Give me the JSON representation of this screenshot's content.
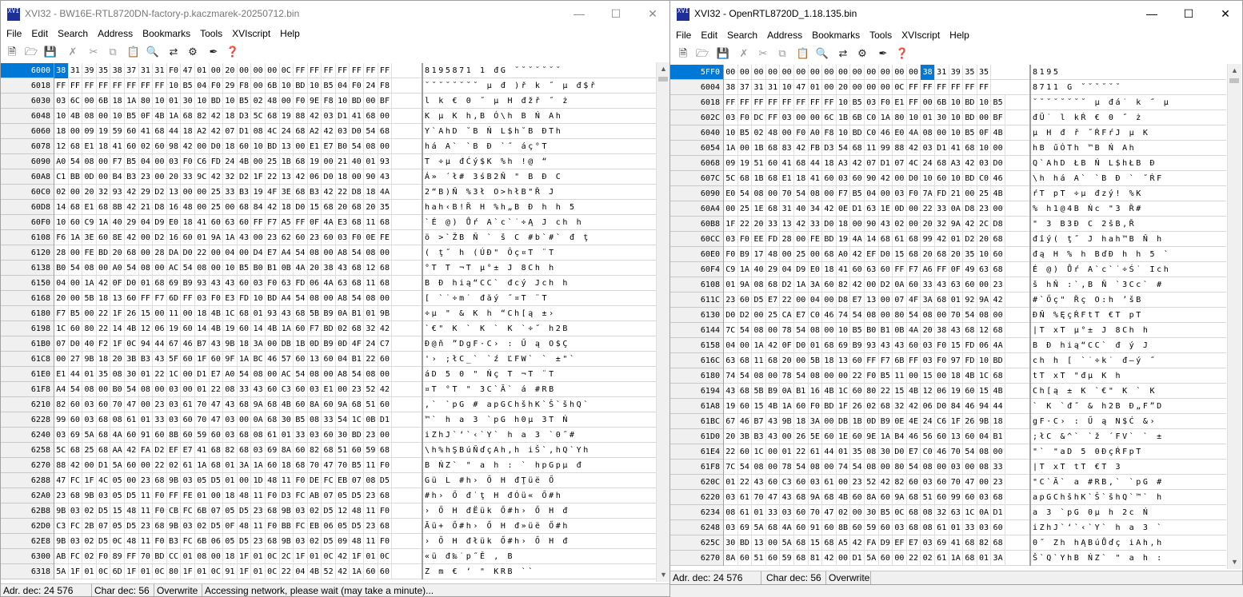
{
  "windows": [
    {
      "title": "XVI32 - BW16E-RTL8720DN-factory-p.kaczmarek-20250712.bin",
      "app_icon_label": "XVI",
      "menus": [
        "File",
        "Edit",
        "Search",
        "Address",
        "Bookmarks",
        "Tools",
        "XVIscript",
        "Help"
      ],
      "rows": [
        {
          "addr": "6000",
          "hex": "38 31 39 35 38 37 31 31 F0 47 01 00 20 00 00 00 0C FF FF FF FF FF FF FF",
          "text": "8195871 1 đG       ˘˘˘˘˘˘˘"
        },
        {
          "addr": "6018",
          "hex": "FF FF FF FF FF FF FF FF 10 B5 04 F0 29 F8 00 6B 10 BD 10 B5 04 F0 24 F8",
          "text": "˘˘˘˘˘˘˘˘ µ đ )ř k ˝ µ đ$ř"
        },
        {
          "addr": "6030",
          "hex": "03 6C 00 6B 18 1A 80 10 01 30 10 BD 10 B5 02 48 00 F0 9E F8 10 BD 00 BF",
          "text": " l  k   € 0 ˝ µ H  đžř ˝ ż"
        },
        {
          "addr": "6048",
          "hex": "10 4B 08 00 10 B5 0F 4B 1A 68 82 42 18 D3 5C 68 19 88 42 03 D1 41 68 00",
          "text": " K  µ K h‚B Ó\\h  B Ń Ah"
        },
        {
          "addr": "6060",
          "hex": "18 00 09 19 59 60 41 68 44 18 A2 42 07 D1 08 4C 24 68 A2 42 03 D0 54 68",
          "text": "   Y`AhD ˘B Ń L$h˘B ĐTh"
        },
        {
          "addr": "6078",
          "hex": "12 68 E1 18 41 60 02 60 98 42 00 D0 18 60 10 BD 13 00 E1 E7 B0 54 08 00",
          "text": " há A` `B Đ `˝  áç°T"
        },
        {
          "addr": "6090",
          "hex": "A0 54 08 00 F7 B5 04 00 03 F0 C6 FD 24 4B 00 25 1B 68 19 00 21 40 01 93",
          "text": " T  ÷µ  đĆý$K %h  !@ “"
        },
        {
          "addr": "60A8",
          "hex": "C1 BB 0D 00 B4 B3 23 00 20 33 9C 42 32 D2 1F 22 13 42 06 D0 18 00 90 43",
          "text": "Á»  ´ł# 3śB2Ň \" B Đ  C"
        },
        {
          "addr": "60C0",
          "hex": "02 00 20 32 93 42 29 D2 13 00 00 25 33 B3 19 4F 3E 68 B3 42 22 D8 18 4A",
          "text": "  2“B)Ň  %3ł O>hłB\"Ř J"
        },
        {
          "addr": "60D8",
          "hex": "14 68 E1 68 8B 42 21 D8 16 48 00 25 00 68 84 42 18 D0 15 68 20 68 20 35",
          "text": " hah‹B!Ř H %h„B Đ h h 5"
        },
        {
          "addr": "60F0",
          "hex": "10 60 C9 1A 40 29 04 D9 E0 18 41 60 63 60 FF F7 A5 FF 0F 4A E3 68 11 68",
          "text": " `É @) Ůŕ A`c`˙÷Ą J ch h"
        },
        {
          "addr": "6108",
          "hex": "F6 1A 3E 60 8E 42 00 D2 16 60 01 9A 1A 43 00 23 62 60 23 60 03 F0 0E FE",
          "text": "ö >`ŽB Ň ` š C #b`#` đ ţ"
        },
        {
          "addr": "6120",
          "hex": "28 00 FE BD 20 68 00 28 DA D0 22 00 04 00 D4 E7 A4 54 08 00 A8 54 08 00",
          "text": "( ţ˝ h (ÚĐ\"   Ôç¤T ¨T"
        },
        {
          "addr": "6138",
          "hex": "B0 54 08 00 A0 54 08 00 AC 54 08 00 10 B5 B0 B1 0B 4A 20 38 43 68 12 68",
          "text": "°T   T  ¬T µ°± J 8Ch h"
        },
        {
          "addr": "6150",
          "hex": "04 00 1A 42 0F D0 01 68 69 B9 93 43 43 60 03 F0 63 FD 06 4A 63 68 11 68",
          "text": "  B Đ hią“CC` đcý Jch h"
        },
        {
          "addr": "6168",
          "hex": "20 00 5B 18 13 60 FF F7 6D FF 03 F0 E3 FD 10 BD A4 54 08 00 A8 54 08 00",
          "text": " [ `˙÷m˙ đăý ˝¤T ¨T"
        },
        {
          "addr": "6180",
          "hex": "F7 B5 00 22 1F 26 15 00 11 00 18 4B 1C 68 01 93 43 68 5B B9 0A B1 01 9B",
          "text": "÷µ \" &   K h “Ch[ą ±› "
        },
        {
          "addr": "6198",
          "hex": "1C 60 80 22 14 4B 12 06 19 60 14 4B 19 60 14 4B 1A 60 F7 BD 02 68 32 42",
          "text": " `€\" K  ` K ` K `÷˝ h2B"
        },
        {
          "addr": "61B0",
          "hex": "07 D0 40 F2 1F 0C 94 44 67 46 B7 43 9B 18 3A 00 DB 1B 0D B9 0D 4F 24 C7",
          "text": " Đ@ň  ”DgF·C› : Ű  ą O$Ç"
        },
        {
          "addr": "61C8",
          "hex": "00 27 9B 18 20 3B B3 43 5F 60 1F 60 9F 1A BC 46 57 60 13 60 04 B1 22 60",
          "text": " '› ;łC_` `ź ĽFW` ` ±\"`"
        },
        {
          "addr": "61E0",
          "hex": "E1 44 01 35 08 30 01 22 1C 00 D1 E7 A0 54 08 00 AC 54 08 00 A8 54 08 00",
          "text": "áD 5 0 \" Ńç T ¬T ¨T"
        },
        {
          "addr": "61F8",
          "hex": "A4 54 08 00 B0 54 08 00 03 00 01 22 08 33 43 60 C3 60 03 E1 00 23 52 42",
          "text": "¤T °T  \" 3C`Ă` á #RB"
        },
        {
          "addr": "6210",
          "hex": "82 60 03 60 70 47 00 23 03 61 70 47 43 68 9A 68 4B 60 8A 60 9A 68 51 60",
          "text": "‚` `pG # apGChšhK`Š`šhQ`"
        },
        {
          "addr": "6228",
          "hex": "99 60 03 68 08 61 01 33 03 60 70 47 03 00 0A 68 30 B5 08 33 54 1C 0B D1",
          "text": "™` h a 3 `pG  h0µ 3T Ń"
        },
        {
          "addr": "6240",
          "hex": "03 69 5A 68 4A 60 91 60 8B 60 59 60 03 68 08 61 01 33 03 60 30 BD 23 00",
          "text": " iZhJ`‘`‹`Y` h a 3 `0˝#"
        },
        {
          "addr": "6258",
          "hex": "5C 68 25 68 AA 42 FA D2 EF E7 41 68 82 68 03 69 8A 60 82 68 51 60 59 68",
          "text": "\\h%hŞBúŇďçAh‚h iŠ`‚hQ`Yh"
        },
        {
          "addr": "6270",
          "hex": "88 42 00 D1 5A 60 00 22 02 61 1A 68 01 3A 1A 60 18 68 70 47 70 B5 11 F0",
          "text": "B ŃZ` \" a h : ` hpGpµ đ"
        },
        {
          "addr": "6288",
          "hex": "47 FC 1F 4C 05 00 23 68 9B 03 05 D5 01 00 1D 48 11 F0 DE FC EB 07 08 D5",
          "text": "Gü L  #h›  Ő  H đŢüë  Ő"
        },
        {
          "addr": "62A0",
          "hex": "23 68 9B 03 05 D5 11 F0 FF FE 01 00 18 48 11 F0 D3 FC AB 07 05 D5 23 68",
          "text": "#h›  Ő đ˙ţ  H đÓü«  Ő#h"
        },
        {
          "addr": "62B8",
          "hex": "9B 03 02 D5 15 48 11 F0 CB FC 6B 07 05 D5 23 68 9B 03 02 D5 12 48 11 F0",
          "text": "›  Ő H đËük  Ő#h›  Ő H đ"
        },
        {
          "addr": "62D0",
          "hex": "C3 FC 2B 07 05 D5 23 68 9B 03 02 D5 0F 48 11 F0 BB FC EB 06 05 D5 23 68",
          "text": "Ăü+ Ő#h›  Ő H đ»üë  Ő#h"
        },
        {
          "addr": "62E8",
          "hex": "9B 03 02 D5 0C 48 11 F0 B3 FC 6B 06 05 D5 23 68 9B 03 02 D5 09 48 11 F0",
          "text": "›  Ő H đłük  Ő#h›  Ő H đ"
        },
        {
          "addr": "6300",
          "hex": "AB FC 02 F0 89 FF 70 BD CC 01 08 00 18 1F 01 0C 2C 1F 01 0C 42 1F 01 0C",
          "text": "«ü đ‰˙p˝Ě    ,  B"
        },
        {
          "addr": "6318",
          "hex": "5A 1F 01 0C 6D 1F 01 0C 80 1F 01 0C 91 1F 01 0C 22 04 4B 52 42 1A 60 60",
          "text": "Z  m  €  ‘  \" KRB ``"
        }
      ],
      "status": {
        "adr": "Adr. dec: 24 576",
        "chr": "Char dec: 56",
        "mode": "Overwrite",
        "msg": "Accessing network, please wait (may take a minute)..."
      }
    },
    {
      "title": "XVI32 - OpenRTL8720D_1.18.135.bin",
      "app_icon_label": "XVI",
      "menus": [
        "File",
        "Edit",
        "Search",
        "Address",
        "Bookmarks",
        "Tools",
        "XVIscript",
        "Help"
      ],
      "rows": [
        {
          "addr": "5FF0",
          "hex": "00 00 00 00 00 00 00 00 00 00 00 00 00 00 38 31 39 35 35",
          "text": "              8195"
        },
        {
          "addr": "6004",
          "hex": "38 37 31 31 10 47 01 00 20 00 00 00 0C FF FF FF FF FF FF",
          "text": "8711 G       ˘˘˘˘˘˘"
        },
        {
          "addr": "6018",
          "hex": "FF FF FF FF FF FF FF FF 10 B5 03 F0 E1 FF 00 6B 10 BD 10 B5",
          "text": "˘˘˘˘˘˘˘˘ µ đá˙ k ˝ µ"
        },
        {
          "addr": "602C",
          "hex": "03 F0 DC FF 03 00 00 6C 1B 6B C0 1A 80 10 01 30 10 BD 00 BF",
          "text": " đÜ˙  l kŔ € 0 ˝ ż"
        },
        {
          "addr": "6040",
          "hex": "10 B5 02 48 00 F0 A0 F8 10 BD C0 46 E0 4A 08 00 10 B5 0F 4B",
          "text": " µ H đ ř ˝ŔFŕJ  µ K"
        },
        {
          "addr": "6054",
          "hex": "1A 00 1B 68 83 42 FB D3 54 68 11 99 88 42 03 D1 41 68 10 00",
          "text": "  hB űÓTh ™B Ń Ah"
        },
        {
          "addr": "6068",
          "hex": "09 19 51 60 41 68 44 18 A3 42 07 D1 07 4C 24 68 A3 42 03 D0",
          "text": " Q`AhD ŁB Ń L$hŁB Đ"
        },
        {
          "addr": "607C",
          "hex": "5C 68 1B 68 E1 18 41 60 03 60 90 42 00 D0 10 60 10 BD C0 46",
          "text": "\\h há A` `B Đ ` ˝ŔF"
        },
        {
          "addr": "6090",
          "hex": "E0 54 08 00 70 54 08 00 F7 B5 04 00 03 F0 7A FD 21 00 25 4B",
          "text": "ŕT  pT  ÷µ  đzý! %K"
        },
        {
          "addr": "60A4",
          "hex": "00 25 1E 68 31 40 34 42 0E D1 63 1E 0D 00 22 33 0A D8 23 00",
          "text": " % h1@4B Ńc  \"3 Ř#"
        },
        {
          "addr": "60B8",
          "hex": "1F 22 20 33 13 42 33 D0 18 00 90 43 02 00 20 32 9A 42 2C D8",
          "text": " \" 3 B3Đ  C   2šB,Ř"
        },
        {
          "addr": "60CC",
          "hex": "03 F0 EE FD 28 00 FE BD 19 4A 14 68 61 68 99 42 01 D2 20 68",
          "text": " đîý( ţ˝ J hah™B Ň h"
        },
        {
          "addr": "60E0",
          "hex": "F0 B9 17 48 00 25 00 68 A0 42 EF D0 15 68 20 68 20 35 10 60",
          "text": "đą H % h BďĐ h h 5 `"
        },
        {
          "addr": "60F4",
          "hex": "C9 1A 40 29 04 D9 E0 18 41 60 63 60 FF F7 A6 FF 0F 49 63 68",
          "text": "É @) Ůŕ A`c`˙÷Ś˙ Ich"
        },
        {
          "addr": "6108",
          "hex": "01 9A 08 68 D2 1A 3A 60 82 42 00 D2 0A 60 33 43 63 60 00 23",
          "text": " š hŇ :`‚B Ň `3Cc` #"
        },
        {
          "addr": "611C",
          "hex": "23 60 D5 E7 22 00 04 00 D8 E7 13 00 07 4F 3A 68 01 92 9A 42",
          "text": "#`Őç\"  Řç  O:h ’šB"
        },
        {
          "addr": "6130",
          "hex": "D0 D2 00 25 CA E7 C0 46 74 54 08 00 80 54 08 00 70 54 08 00",
          "text": "ĐŇ %ĘçŔFtT €T pT"
        },
        {
          "addr": "6144",
          "hex": "7C 54 08 00 78 54 08 00 10 B5 B0 B1 0B 4A 20 38 43 68 12 68",
          "text": "|T xT  µ°± J 8Ch h"
        },
        {
          "addr": "6158",
          "hex": "04 00 1A 42 0F D0 01 68 69 B9 93 43 43 60 03 F0 15 FD 06 4A",
          "text": "  B Đ hią“CC` đ ý J"
        },
        {
          "addr": "616C",
          "hex": "63 68 11 68 20 00 5B 18 13 60 FF F7 6B FF 03 F0 97 FD 10 BD",
          "text": "ch h [ `˙÷k˙ đ—ý ˝"
        },
        {
          "addr": "6180",
          "hex": "74 54 08 00 78 54 08 00 00 22 F0 B5 11 00 15 00 18 4B 1C 68",
          "text": "tT xT  \"đµ   K h"
        },
        {
          "addr": "6194",
          "hex": "43 68 5B B9 0A B1 16 4B 1C 60 80 22 15 4B 12 06 19 60 15 4B",
          "text": "Ch[ą ± K `€\" K  ` K"
        },
        {
          "addr": "61A8",
          "hex": "19 60 15 4B 1A 60 F0 BD 1F 26 02 68 32 42 06 D0 84 46 94 44",
          "text": " ` K `đ˝ & h2B Đ„F”D"
        },
        {
          "addr": "61BC",
          "hex": "67 46 B7 43 9B 18 3A 00 DB 1B 0D B9 0E 4E 24 C6 1F 26 9B 18",
          "text": "gF·C› : Ű  ą N$Ć &›"
        },
        {
          "addr": "61D0",
          "hex": "20 3B B3 43 00 26 5E 60 1E 60 9E 1A B4 46 56 60 13 60 04 B1",
          "text": " ;łC &^` `ž ´FV` ` ±"
        },
        {
          "addr": "61E4",
          "hex": "22 60 1C 00 01 22 61 44 01 35 08 30 D0 E7 C0 46 70 54 08 00",
          "text": "\"`  \"aD 5 0ĐçŔFpT"
        },
        {
          "addr": "61F8",
          "hex": "7C 54 08 00 78 54 08 00 74 54 08 00 80 54 08 00 03 00 08 33",
          "text": "|T xT tT €T   3"
        },
        {
          "addr": "620C",
          "hex": "01 22 43 60 C3 60 03 61 00 23 52 42 82 60 03 60 70 47 00 23",
          "text": " \"C`Ă` a #RB‚` `pG #"
        },
        {
          "addr": "6220",
          "hex": "03 61 70 47 43 68 9A 68 4B 60 8A 60 9A 68 51 60 99 60 03 68",
          "text": " apGChšhK`Š`šhQ`™` h"
        },
        {
          "addr": "6234",
          "hex": "08 61 01 33 03 60 70 47 02 00 30 B5 0C 68 08 32 63 1C 0A D1",
          "text": " a 3 `pG  0µ h 2c  Ń"
        },
        {
          "addr": "6248",
          "hex": "03 69 5A 68 4A 60 91 60 8B 60 59 60 03 68 08 61 01 33 03 60",
          "text": " iZhJ`‘`‹`Y` h a 3 `"
        },
        {
          "addr": "625C",
          "hex": "30 BD 13 00 5A 68 15 68 A5 42 FA D9 EF E7 03 69 41 68 82 68",
          "text": "0˝  Zh hĄBúŮďç iAh‚h"
        },
        {
          "addr": "6270",
          "hex": "8A 60 51 60 59 68 81 42 00 D1 5A 60 00 22 02 61 1A 68 01 3A",
          "text": "Š`Q`YhB ŃZ` \" a h :"
        }
      ],
      "status": {
        "adr": "Adr. dec: 24 576",
        "chr": "Char dec: 56",
        "mode": "Overwrite"
      }
    }
  ]
}
